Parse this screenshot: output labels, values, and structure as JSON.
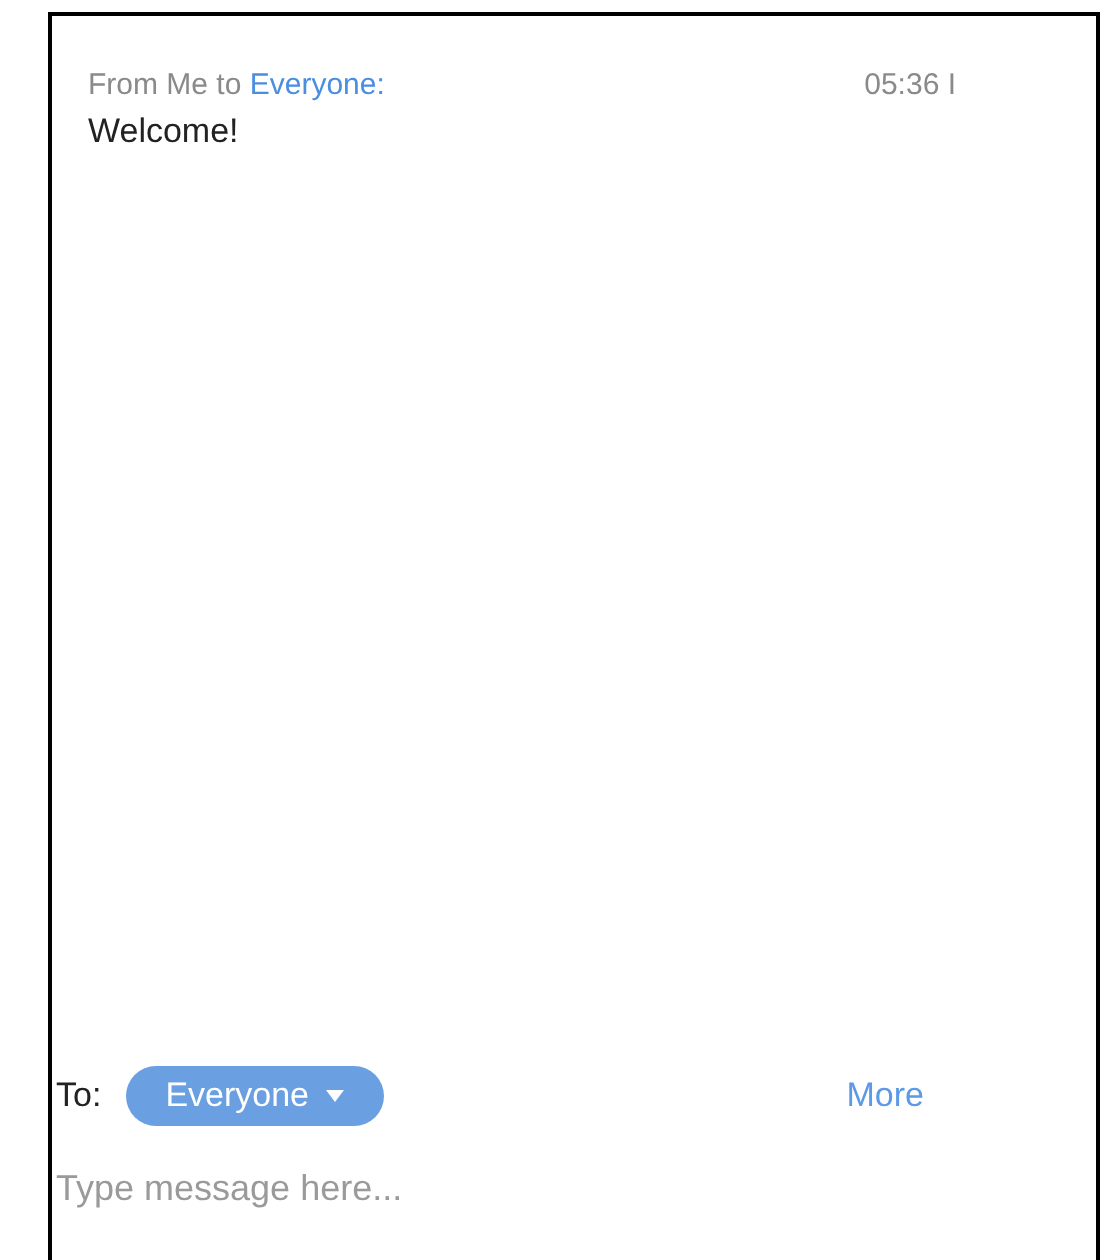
{
  "messages": [
    {
      "sender": "From Me to",
      "recipient": "Everyone:",
      "time": "05:36 I",
      "text": "Welcome!"
    }
  ],
  "composer": {
    "to_label": "To:",
    "recipient": "Everyone",
    "more": "More",
    "placeholder": "Type message here..."
  }
}
